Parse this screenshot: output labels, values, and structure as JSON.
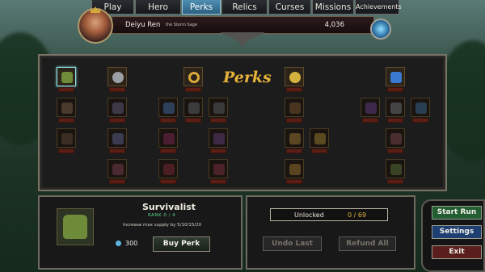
{
  "nav": {
    "tabs": [
      {
        "label": "Play"
      },
      {
        "label": "Hero"
      },
      {
        "label": "Perks"
      },
      {
        "label": "Relics"
      },
      {
        "label": "Curses"
      },
      {
        "label": "Missions"
      },
      {
        "label": "Achievements"
      }
    ],
    "active": "Perks"
  },
  "player": {
    "name": "Deiyu Ren",
    "title": "the Storm Sage",
    "gold": "4,036"
  },
  "perks": {
    "title": "Perks"
  },
  "selected_perk": {
    "name": "Survivalist",
    "rank": "RANK 0 / 4",
    "description": "Increase max supply by 5/10/15/20",
    "cost": "300",
    "buy_label": "Buy Perk",
    "icon": "backpack-icon"
  },
  "unlock": {
    "label": "Unlocked",
    "count": "0 / 69",
    "undo_label": "Undo Last",
    "refund_label": "Refund All"
  },
  "side_buttons": {
    "start_label": "Start Run",
    "settings_label": "Settings",
    "exit_label": "Exit"
  },
  "colors": {
    "accent_gold": "#e7b23a",
    "active_tab": "#4f8fb2",
    "rank_green": "#5fd28a"
  }
}
